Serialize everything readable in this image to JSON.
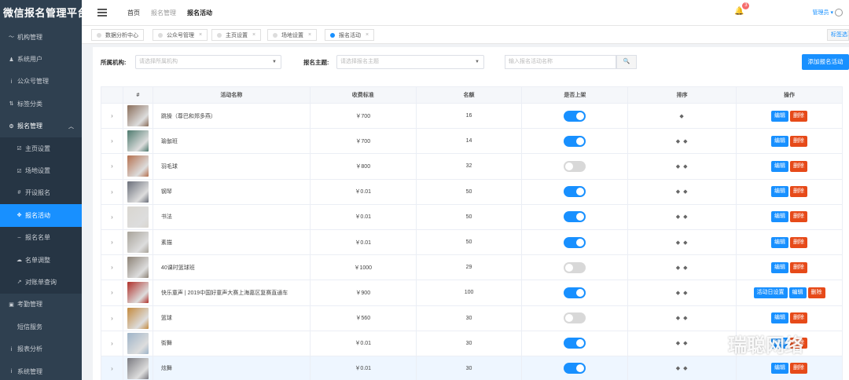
{
  "app": {
    "brand": "微信报名管理平台"
  },
  "sidebar": {
    "items": [
      {
        "label": "机构管理",
        "icon": "chart-icon",
        "glyph": "〜"
      },
      {
        "label": "系统用户",
        "icon": "user-icon",
        "glyph": "♟"
      },
      {
        "label": "公众号管理",
        "icon": "wechat-icon",
        "glyph": "ⅰ"
      },
      {
        "label": "标签分类",
        "icon": "tag-icon",
        "glyph": "⇅"
      },
      {
        "label": "报名管理",
        "icon": "gear-icon",
        "glyph": "⚙",
        "open": true
      }
    ],
    "subitems": [
      {
        "label": "主页设置",
        "icon": "edit-icon",
        "glyph": "☑"
      },
      {
        "label": "场地设置",
        "icon": "edit-icon",
        "glyph": "☑"
      },
      {
        "label": "开设报名",
        "icon": "hash-icon",
        "glyph": "#"
      },
      {
        "label": "报名活动",
        "icon": "crosshair-icon",
        "glyph": "✥",
        "active": true
      },
      {
        "label": "报名名单",
        "icon": "dash-icon",
        "glyph": "–"
      },
      {
        "label": "名单调整",
        "icon": "cloud-icon",
        "glyph": "☁"
      },
      {
        "label": "对账单查询",
        "icon": "trend-icon",
        "glyph": "↗"
      }
    ],
    "bottom": [
      {
        "label": "考勤管理",
        "icon": "camera-icon",
        "glyph": "▣"
      },
      {
        "label": "短信服务",
        "icon": "",
        "glyph": ""
      },
      {
        "label": "报表分析",
        "icon": "info-icon",
        "glyph": "ⅰ"
      },
      {
        "label": "系统管理",
        "icon": "info-icon",
        "glyph": "ⅰ"
      }
    ]
  },
  "topbar": {
    "breadcrumb": [
      "首页",
      "报名管理",
      "报名活动"
    ],
    "notification_count": "3",
    "user": "管理员 ▾"
  },
  "tabs": [
    {
      "label": "数据分析中心",
      "closable": false
    },
    {
      "label": "公众号管理",
      "closable": true
    },
    {
      "label": "主页设置",
      "closable": true
    },
    {
      "label": "场地设置",
      "closable": true
    },
    {
      "label": "报名活动",
      "closable": true,
      "active": true
    }
  ],
  "tab_options": "标签选项",
  "filters": {
    "org_label": "所属机构:",
    "org_placeholder": "请选择所属机构",
    "topic_label": "报名主题:",
    "topic_placeholder": "请选择报名主题",
    "search_placeholder": "输入报名活动名称",
    "add_button": "添加报名活动"
  },
  "table": {
    "columns": [
      "",
      "#",
      "活动名称",
      "收费标准",
      "名额",
      "是否上架",
      "排序",
      "操作"
    ],
    "rows": [
      {
        "name": "跳操（尊巴和郑多燕）",
        "fee": "￥700",
        "quota": "16",
        "on_shelf": true,
        "sort": "◆",
        "thumb": "#8a6d5a",
        "ops": [
          "编辑",
          "删除"
        ]
      },
      {
        "name": "瑜伽班",
        "fee": "￥700",
        "quota": "14",
        "on_shelf": true,
        "sort": "◆ ◆",
        "thumb": "#4e7a6e",
        "ops": [
          "编辑",
          "删除"
        ]
      },
      {
        "name": "羽毛球",
        "fee": "￥800",
        "quota": "32",
        "on_shelf": false,
        "sort": "◆ ◆",
        "thumb": "#b5704f",
        "ops": [
          "编辑",
          "删除"
        ]
      },
      {
        "name": "钢琴",
        "fee": "￥0.01",
        "quota": "50",
        "on_shelf": true,
        "sort": "◆ ◆",
        "thumb": "#6b6f7a",
        "ops": [
          "编辑",
          "删除"
        ]
      },
      {
        "name": "书法",
        "fee": "￥0.01",
        "quota": "50",
        "on_shelf": true,
        "sort": "◆ ◆",
        "thumb": "#d9d6d0",
        "ops": [
          "编辑",
          "删除"
        ]
      },
      {
        "name": "素描",
        "fee": "￥0.01",
        "quota": "50",
        "on_shelf": true,
        "sort": "◆ ◆",
        "thumb": "#a8a39a",
        "ops": [
          "编辑",
          "删除"
        ]
      },
      {
        "name": "40课时篮球班",
        "fee": "￥1000",
        "quota": "29",
        "on_shelf": false,
        "sort": "◆ ◆",
        "thumb": "#8c8276",
        "ops": [
          "编辑",
          "删除"
        ]
      },
      {
        "name": "快乐童声 | 2019中国好童声大赛上海嘉区复赛直通车",
        "fee": "￥900",
        "quota": "100",
        "on_shelf": true,
        "sort": "◆ ◆",
        "thumb": "#b0302a",
        "ops": [
          "活动日设置",
          "编辑",
          "删除"
        ]
      },
      {
        "name": "篮球",
        "fee": "￥560",
        "quota": "30",
        "on_shelf": false,
        "sort": "◆ ◆",
        "thumb": "#c48a3e",
        "ops": [
          "编辑",
          "删除"
        ]
      },
      {
        "name": "街舞",
        "fee": "￥0.01",
        "quota": "30",
        "on_shelf": true,
        "sort": "◆ ◆",
        "thumb": "#9db3c8",
        "ops": [
          "编辑",
          "删除"
        ]
      },
      {
        "name": "炫舞",
        "fee": "￥0.01",
        "quota": "30",
        "on_shelf": true,
        "sort": "◆ ◆",
        "thumb": "#7a7a80",
        "ops": [
          "编辑",
          "删除"
        ],
        "highlight": true
      }
    ]
  },
  "watermark": "瑞聪网络",
  "colors": {
    "primary": "#1890ff",
    "danger": "#e64a19",
    "sidebar": "#2f4050"
  }
}
